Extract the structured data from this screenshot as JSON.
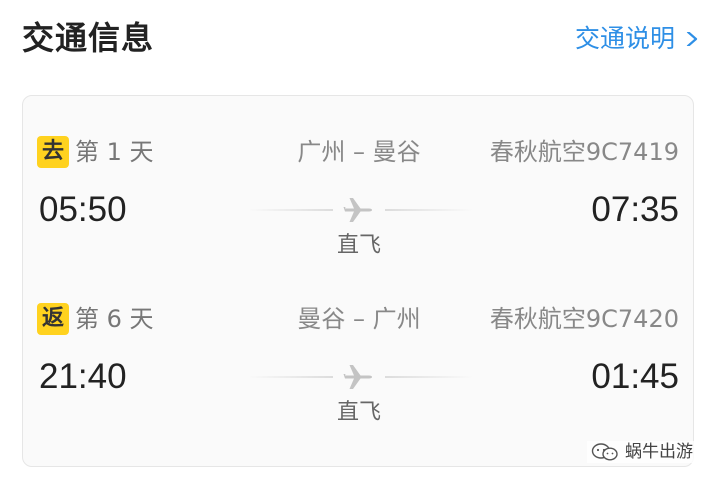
{
  "header": {
    "title": "交通信息",
    "explain_link": "交通说明"
  },
  "legs": [
    {
      "badge": "去",
      "day": "第 1 天",
      "route": "广州 – 曼谷",
      "airline": "春秋航空9C7419",
      "depart_time": "05:50",
      "arrive_time": "07:35",
      "flight_type": "直飞"
    },
    {
      "badge": "返",
      "day": "第 6 天",
      "route": "曼谷 – 广州",
      "airline": "春秋航空9C7420",
      "depart_time": "21:40",
      "arrive_time": "01:45",
      "flight_type": "直飞"
    }
  ],
  "watermark": {
    "text": "蜗牛出游"
  },
  "colors": {
    "accent_link": "#2e8fe6",
    "badge_yellow": "#ffd21f",
    "card_background": "#fafafa"
  },
  "icons": {
    "link_chevron": "chevron-right-icon",
    "plane": "plane-icon",
    "watermark_logo": "wechat-icon"
  }
}
